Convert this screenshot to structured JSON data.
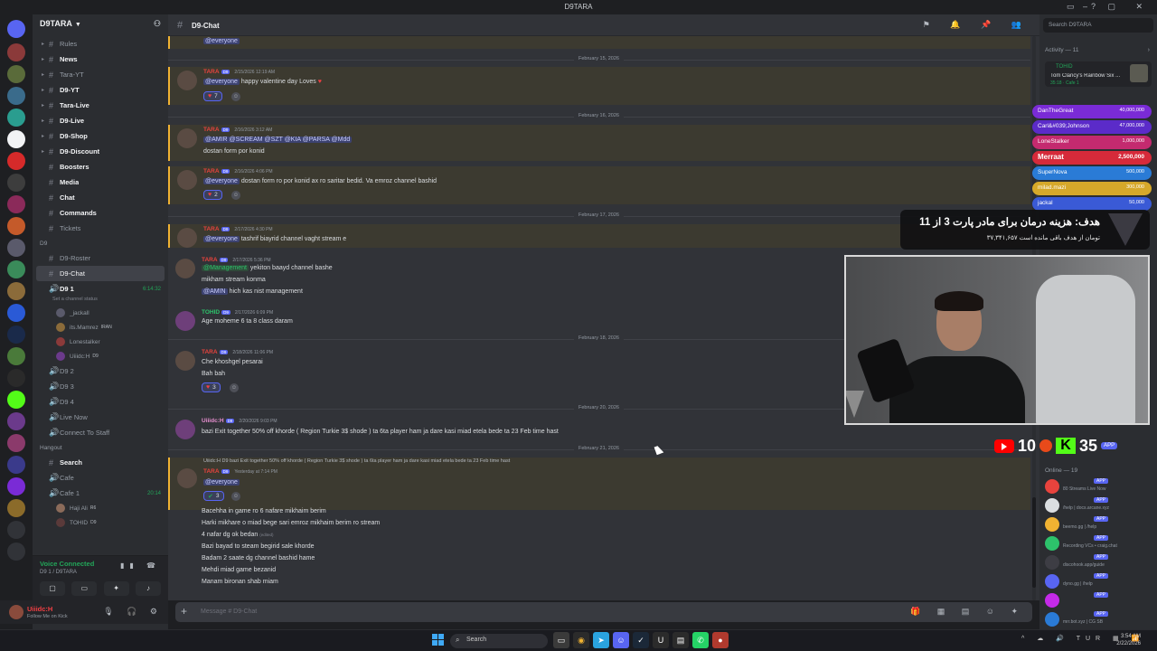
{
  "window": {
    "title": "D9TARA",
    "server_name": "D9TARA",
    "channel_name": "D9-Chat",
    "search_placeholder": "Search D9TARA"
  },
  "channels": [
    {
      "label": "Rules",
      "bold": false
    },
    {
      "label": "News",
      "bold": true
    },
    {
      "label": "Tara-YT",
      "bold": false
    },
    {
      "label": "D9-YT",
      "bold": true
    },
    {
      "label": "Tara-Live",
      "bold": true
    },
    {
      "label": "D9-Live",
      "bold": true
    },
    {
      "label": "D9-Shop",
      "bold": true
    },
    {
      "label": "D9-Discount",
      "bold": true
    },
    {
      "label": "Boosters",
      "bold": true
    },
    {
      "label": "Media",
      "bold": true
    },
    {
      "label": "Chat",
      "bold": true
    },
    {
      "label": "Commands",
      "bold": true
    },
    {
      "label": "Tickets",
      "bold": false
    }
  ],
  "category_d9": "D9",
  "channels_d9": [
    {
      "label": "D9-Roster"
    },
    {
      "label": "D9-Chat"
    }
  ],
  "voice_d91": {
    "label": "D9 1",
    "time": "6:14:32",
    "status": "Set a channel status"
  },
  "voice_users": [
    {
      "name": "_jackall",
      "tag": ""
    },
    {
      "name": "its.Mamrez",
      "tag": "IRAN"
    },
    {
      "name": "Lonestalker",
      "tag": ""
    },
    {
      "name": "Uiiidc:H",
      "tag": "D9"
    }
  ],
  "voice_more": [
    "D9 2",
    "D9 3",
    "D9 4",
    "Live Now",
    "Connect To Staff"
  ],
  "category_hangout": "Hangout",
  "hangout": [
    {
      "label": "Search",
      "time": ""
    },
    {
      "label": "Cafe",
      "time": ""
    },
    {
      "label": "Cafe 1",
      "time": "20:14"
    }
  ],
  "cafe_users": [
    {
      "name": "Haji Ali",
      "tag": "R6"
    },
    {
      "name": "TOHID",
      "tag": "D9"
    }
  ],
  "voicebar": {
    "status": "Voice Connected",
    "channel": "D9 1 / D9TARA"
  },
  "user": {
    "name": "Uiiidc:H",
    "status": "Follow Me on Kick"
  },
  "messages": {
    "top_mention": "@everyone",
    "d1": "February 15, 2026",
    "m1": {
      "author": "TARA",
      "badge": "D9",
      "time": "2/15/2026 12:19 AM",
      "mention": "@everyone",
      "text": "happy valentine day Loves",
      "react": "7"
    },
    "d2": "February 16, 2026",
    "m2": {
      "author": "TARA",
      "badge": "D9",
      "time": "2/16/2026 3:12 AM",
      "mentions": "@AMIR @SCREAM @SZT @KIA @PARSA @Mdd",
      "text": "dostan form por konid"
    },
    "m3": {
      "author": "TARA",
      "badge": "D9",
      "time": "2/16/2026 4:06 PM",
      "mention": "@everyone",
      "text": "dostan form ro por konid ax ro saritar bedid. Va emroz channel bashid",
      "react": "2"
    },
    "d3": "February 17, 2026",
    "m4": {
      "author": "TARA",
      "badge": "D9",
      "time": "2/17/2026 4:30 PM",
      "mention": "@everyone",
      "text": "tashrif biayrid channel vaght stream e"
    },
    "m5": {
      "author": "TARA",
      "badge": "D9",
      "time": "2/17/2026 5:36 PM",
      "mention": "@Management",
      "text": "yekiton baayd channel bashe",
      "line2": "mikham stream konma",
      "mention3": "@AMIN",
      "line3": "hich kas nist management"
    },
    "m6": {
      "author": "TOHID",
      "badge": "D9",
      "time": "2/17/2026 6:09 PM",
      "text": "Age moheme 6 ta 8 class daram"
    },
    "d4": "February 18, 2026",
    "m7": {
      "author": "TARA",
      "badge": "D9",
      "time": "2/18/2026 11:06 PM",
      "text": "Che khoshgel pesarai",
      "line2": "Bah bah",
      "react": "3"
    },
    "d5": "February 20, 2026",
    "m8": {
      "author": "Uiiidc:H",
      "badge": "D9",
      "time": "2/20/2026 9:03 PM",
      "text": "bazi Exit together 50% off khorde ( Region Turkie 3$ shode )  ta 6ta player ham ja dare kasi miad etela bede  ta 23 Feb time hast"
    },
    "d6": "February 21, 2026",
    "m9": {
      "reply": "Uiiidc:H  D9  bazi Exit together 50% off khorde ( Region Turkie 3$ shode )  ta 6ta player ham ja dare kasi miad etela bede  ta 23 Feb time hast",
      "author": "TARA",
      "badge": "D9",
      "time": "Yesterday at 7:14 PM",
      "mention": "@everyone",
      "react": "3",
      "lines": [
        "Bacehha in game ro 6 nafare mikhaim berim",
        "Harki mikhare o miad bege sari emroz mikhaim berim ro stream",
        "4 nafar dg ok bedan",
        "Bazi bayad to steam  begirid sale khorde",
        "Badam 2 saate dg channel bashid hame",
        "Mehdi miad game bezanid",
        "Manam bironan shab miam"
      ],
      "edited": "(edited)"
    }
  },
  "chat_placeholder": "Message # D9-Chat",
  "activity": {
    "title": "Activity — 11",
    "user": "TOHID",
    "game": "Tom Clancy's Rainbow Six ...",
    "time": "35:18",
    "where": "Cafe 1"
  },
  "goals": [
    {
      "name": "DanTheGreat",
      "value": "40,000,000",
      "color": "#7a2bd6"
    },
    {
      "name": "Carl&#039;Johnson",
      "value": "47,000,000",
      "color": "#5b2bc9"
    },
    {
      "name": "LoneStalker",
      "value": "1,000,000",
      "color": "#c42a6f"
    },
    {
      "name": "Merraat",
      "value": "2,500,000",
      "color": "#d62a3a"
    },
    {
      "name": "SuperNova",
      "value": "500,000",
      "color": "#2a7bd6"
    },
    {
      "name": "milad.mazi",
      "value": "300,000",
      "color": "#d6a82a"
    },
    {
      "name": "jackal",
      "value": "50,000",
      "color": "#3a5ad6"
    }
  ],
  "donation": {
    "title": "هدف: هزینه درمان برای مادر پارت 3 از 11",
    "sub": "۳۷,۳۴۱,۶۵۷ تومان از هدف باقی مانده است"
  },
  "counters": {
    "youtube": "10",
    "kick": "35"
  },
  "online": {
    "title": "Online — 19",
    "items": [
      {
        "status": "80 Streams Live Now",
        "color": "#e8433d"
      },
      {
        "status": "/help | docs.arcane.xyz",
        "color": "#dbdee1"
      },
      {
        "status": "beemo.gg | /help",
        "color": "#f0b232"
      },
      {
        "status": "Recording VCs • craig.chat",
        "color": "#2dc26b"
      },
      {
        "status": "discohook.app/guide",
        "color": "#b5bac1"
      },
      {
        "status": "dyno.gg | /help",
        "color": "#5865f2"
      },
      {
        "status": "",
        "color": "#c42ae8"
      },
      {
        "status": "mrr.bot.xyz | CG SB",
        "color": "#2a7bd6"
      }
    ],
    "app_label": "APP"
  },
  "taskbar": {
    "search": "Search",
    "lang": "TUR",
    "time": "3:54 AM",
    "date": "2/22/2026"
  }
}
